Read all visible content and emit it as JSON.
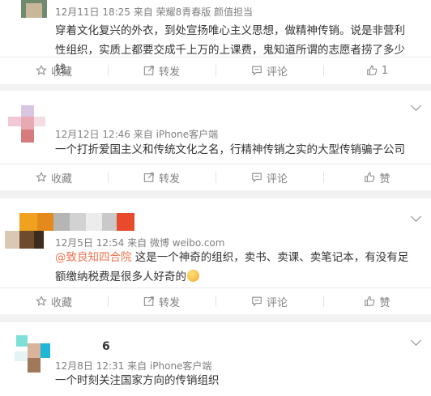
{
  "posts": [
    {
      "meta": "12月11日 18:25 来自 荣耀8青春版 颜值担当",
      "text": "穿着文化复兴的外衣，到处宣扬唯心主义思想，做精神传销。说是非营利性组织，实质上都要交成千上万的上课费，鬼知道所谓的志愿者捞了多少钱。",
      "actions": {
        "fav": "收藏",
        "repost": "转发",
        "comment": "评论",
        "like": "1"
      }
    },
    {
      "meta": "12月12日 12:46 来自 iPhone客户端",
      "text": "一个打折爱国主义和传统文化之名，行精神传销之实的大型传销骗子公司",
      "actions": {
        "fav": "收藏",
        "repost": "转发",
        "comment": "评论",
        "like": "赞"
      }
    },
    {
      "meta": "12月5日 12:54 来自 微博 weibo.com",
      "mention": "@致良知四合院",
      "text": " 这是一个神奇的组织，卖书、卖课、卖笔记本，有没有足额缴纳税费是很多人好奇的",
      "emoji": "smirk-emoji",
      "actions": {
        "fav": "收藏",
        "repost": "转发",
        "comment": "评论",
        "like": "赞"
      }
    },
    {
      "name": "6",
      "meta": "12月8日 12:31 来自 iPhone客户端",
      "text": "一个时刻关注国家方向的传销组织"
    }
  ],
  "icons": {
    "fav": "star-icon",
    "repost": "repost-icon",
    "comment": "comment-icon",
    "like": "thumbs-up-icon",
    "more": "chevron-down-icon"
  },
  "colors": {
    "mention": "#eb7350",
    "meta": "#808080",
    "background": "#f2f2f2"
  }
}
